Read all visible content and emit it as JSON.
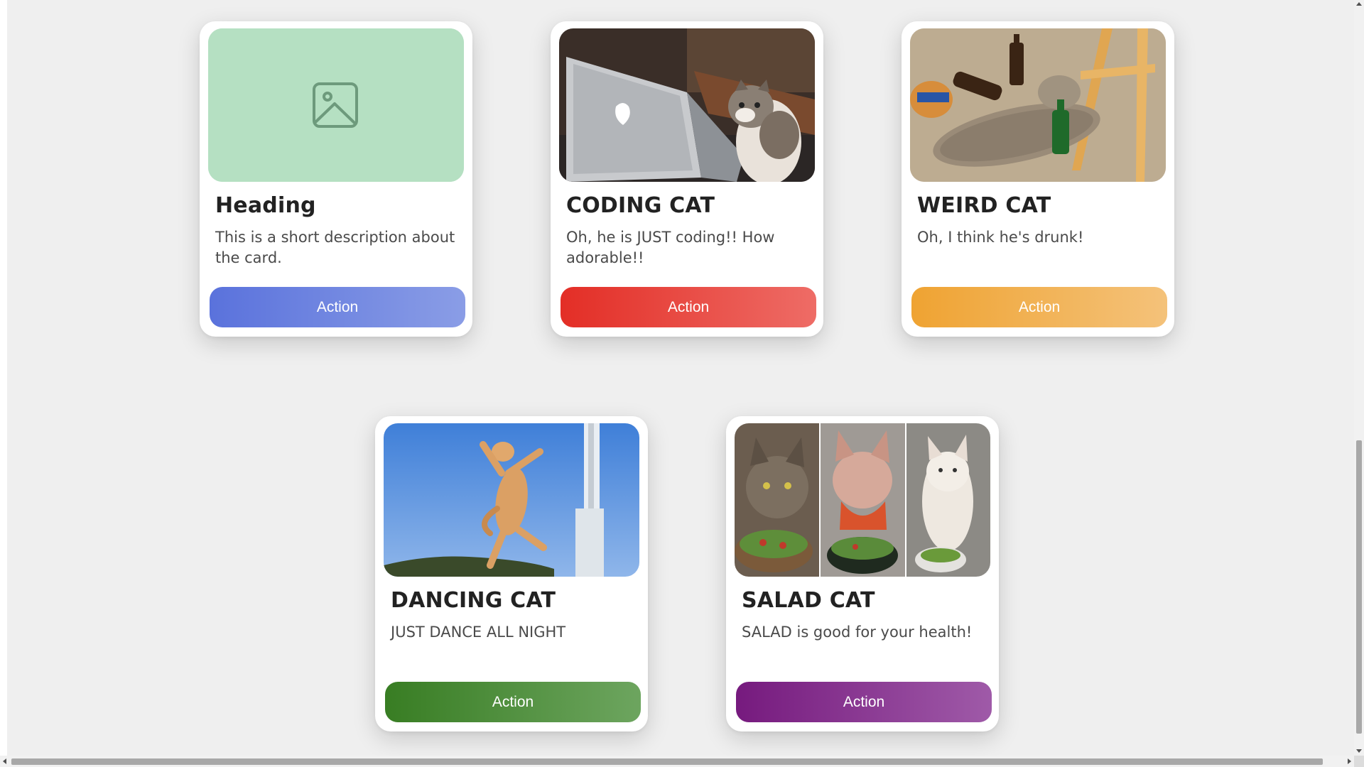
{
  "cards": [
    {
      "heading": "Heading",
      "description": "This is a short description about the card.",
      "action_label": "Action",
      "image_icon": "image-placeholder-icon",
      "button_gradient": [
        "#5a72dc",
        "#8a9de6"
      ]
    },
    {
      "heading": "CODING CAT",
      "description": "Oh, he is JUST coding!! How adorable!!",
      "action_label": "Action",
      "image_icon": "coding-cat-photo",
      "button_gradient": [
        "#e32e26",
        "#ee6c66"
      ]
    },
    {
      "heading": "WEIRD CAT",
      "description": "Oh, I think he's drunk!",
      "action_label": "Action",
      "image_icon": "weird-cat-photo",
      "button_gradient": [
        "#efa332",
        "#f4c27a"
      ]
    },
    {
      "heading": "DANCING CAT",
      "description": "JUST DANCE ALL NIGHT",
      "action_label": "Action",
      "image_icon": "dancing-cat-photo",
      "button_gradient": [
        "#387d23",
        "#6da55f"
      ]
    },
    {
      "heading": "SALAD CAT",
      "description": "SALAD is good for your health!",
      "action_label": "Action",
      "image_icon": "salad-cat-photo",
      "button_gradient": [
        "#761a7e",
        "#9f5aa8"
      ]
    }
  ]
}
